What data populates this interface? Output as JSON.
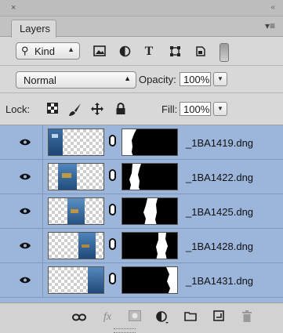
{
  "panel": {
    "close_glyph": "×",
    "collapse_glyph": "«",
    "tab_label": "Layers",
    "menu_glyph": "▾≡"
  },
  "filter": {
    "kind_label": "Kind",
    "icons": [
      "pixel-filter-icon",
      "adjustment-filter-icon",
      "type-filter-icon",
      "shape-filter-icon",
      "smart-object-filter-icon"
    ],
    "type_glyph": "T"
  },
  "blend": {
    "mode": "Normal",
    "opacity_label": "Opacity:",
    "opacity_value": "100%"
  },
  "lock": {
    "label": "Lock:",
    "fill_label": "Fill:",
    "fill_value": "100%"
  },
  "layers": [
    {
      "name": "_1BA1419.dng",
      "visible": true
    },
    {
      "name": "_1BA1422.dng",
      "visible": true
    },
    {
      "name": "_1BA1425.dng",
      "visible": true
    },
    {
      "name": "_1BA1428.dng",
      "visible": true
    },
    {
      "name": "_1BA1431.dng",
      "visible": true
    }
  ],
  "selection_color": "#9cb6db",
  "bottom": {
    "fx_label": "fx",
    "icons": [
      "link-layers-icon",
      "layer-style-icon",
      "add-mask-icon",
      "adjustment-layer-icon",
      "new-group-icon",
      "new-layer-icon",
      "delete-layer-icon"
    ]
  }
}
